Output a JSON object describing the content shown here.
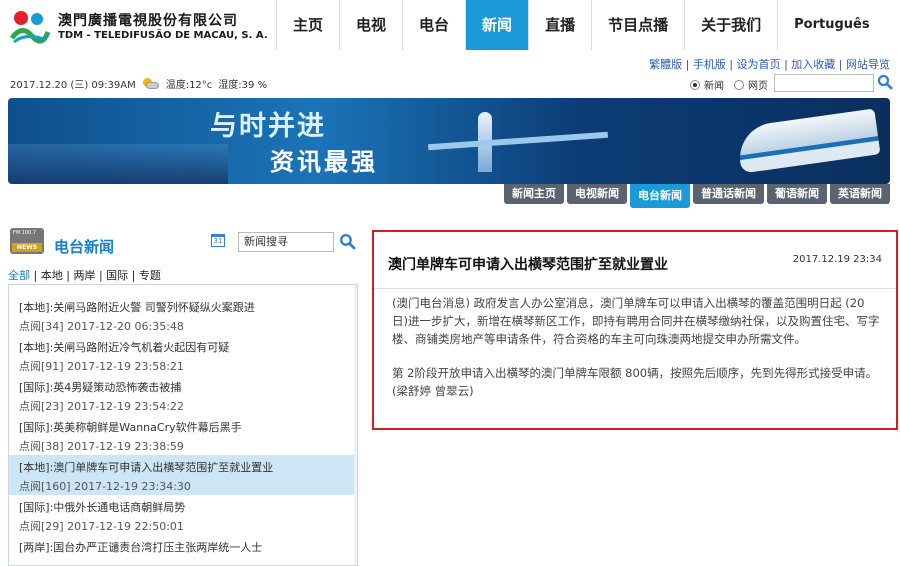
{
  "header": {
    "brand_cn": "澳門廣播電視股份有限公司",
    "brand_pt": "TDM - TELEDIFUSÃO DE MACAU, S. A.",
    "nav": [
      "主页",
      "电视",
      "电台",
      "新闻",
      "直播",
      "节目点播",
      "关于我们",
      "Português"
    ],
    "nav_active": "新闻"
  },
  "utility": {
    "links": [
      "繁體版",
      "手机版",
      "设为首页",
      "加入收藏",
      "网站导览"
    ],
    "sep": "|"
  },
  "datebar": {
    "date": "2017.12.20 (三) 09:39AM",
    "temp": "温度:12°c",
    "humidity": "湿度:39 %"
  },
  "search_scope": {
    "options": [
      "新闻",
      "网页"
    ],
    "selected": "新闻"
  },
  "banner": {
    "line1": "与时并进",
    "line2": "资讯最强"
  },
  "subtabs": [
    "新闻主页",
    "电视新闻",
    "电台新闻",
    "普通话新闻",
    "葡语新闻",
    "英语新闻"
  ],
  "subtab_active": "电台新闻",
  "left": {
    "logo_fm": "FM 100.7",
    "logo_news": "NEWS",
    "title": "电台新闻",
    "search_placeholder": "新闻搜寻",
    "categories": [
      "全部",
      "本地",
      "两岸",
      "国际",
      "专题"
    ],
    "items": [
      {
        "title": "[本地]:关闸马路附近火警 司警列怀疑纵火案跟进",
        "meta": "点阅[34] 2017-12-20 06:35:48"
      },
      {
        "title": "[本地]:关闸马路附近冷气机着火起因有可疑",
        "meta": "点阅[91] 2017-12-19 23:58:21"
      },
      {
        "title": "[国际]:英4男疑策动恐怖袭击被捕",
        "meta": "点阅[23] 2017-12-19 23:54:22"
      },
      {
        "title": "[国际]:英美称朝鲜是WannaCry软件幕后黑手",
        "meta": "点阅[38] 2017-12-19 23:38:59"
      },
      {
        "title": "[本地]:澳门单牌车可申请入出横琴范围扩至就业置业",
        "meta": "点阅[160] 2017-12-19 23:34:30",
        "active": true
      },
      {
        "title": "[国际]:中俄外长通电话商朝鲜局势",
        "meta": "点阅[29] 2017-12-19 22:50:01"
      },
      {
        "title": "[两岸]:国台办严正谴责台湾打压主张两岸统一人士",
        "meta": ""
      }
    ]
  },
  "article": {
    "title": "澳门单牌车可申请入出横琴范围扩至就业置业",
    "date": "2017.12.19 23:34",
    "p1": "(澳门电台消息) 政府发言人办公室消息，澳门单牌车可以申请入出横琴的覆盖范围明日起 (20日)进一步扩大，新增在横琴新区工作，即持有聘用合同并在横琴缴纳社保，以及购置住宅、写字楼、商铺类房地产等申请条件，符合资格的车主可向珠澳两地提交申办所需文件。",
    "p2": "第 2阶段开放申请入出横琴的澳门单牌车限额 800辆，按照先后顺序，先到先得形式接受申请。 (梁舒婷 曾翠云)"
  },
  "colors": {
    "accent": "#1a9bd7",
    "highlight_border": "#d61c1c",
    "active_row": "#cce6f5"
  }
}
